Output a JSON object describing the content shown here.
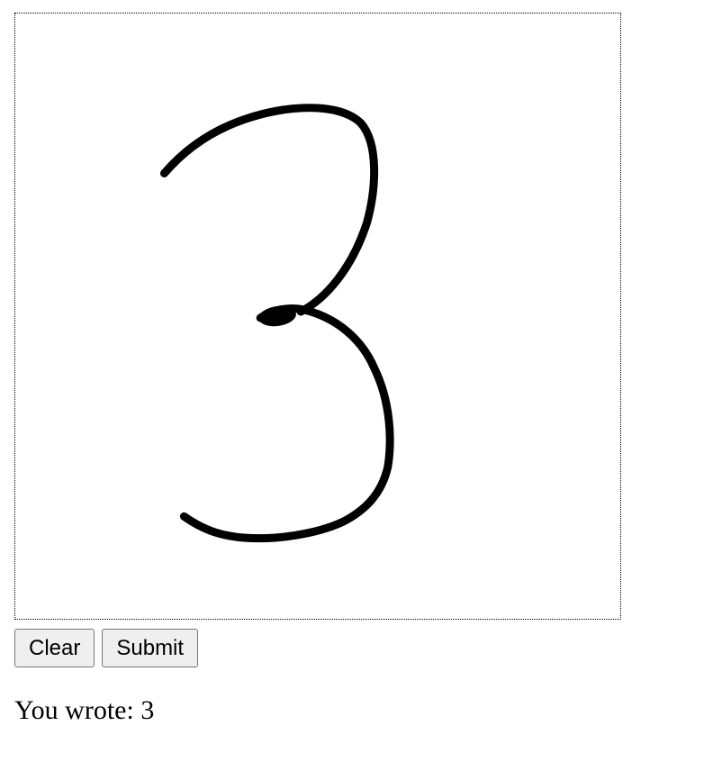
{
  "canvas": {
    "drawn_digit": "3",
    "stroke_color": "#000000",
    "border_color": "#000000"
  },
  "buttons": {
    "clear_label": "Clear",
    "submit_label": "Submit"
  },
  "result": {
    "prefix": "You wrote:",
    "value": "3"
  }
}
